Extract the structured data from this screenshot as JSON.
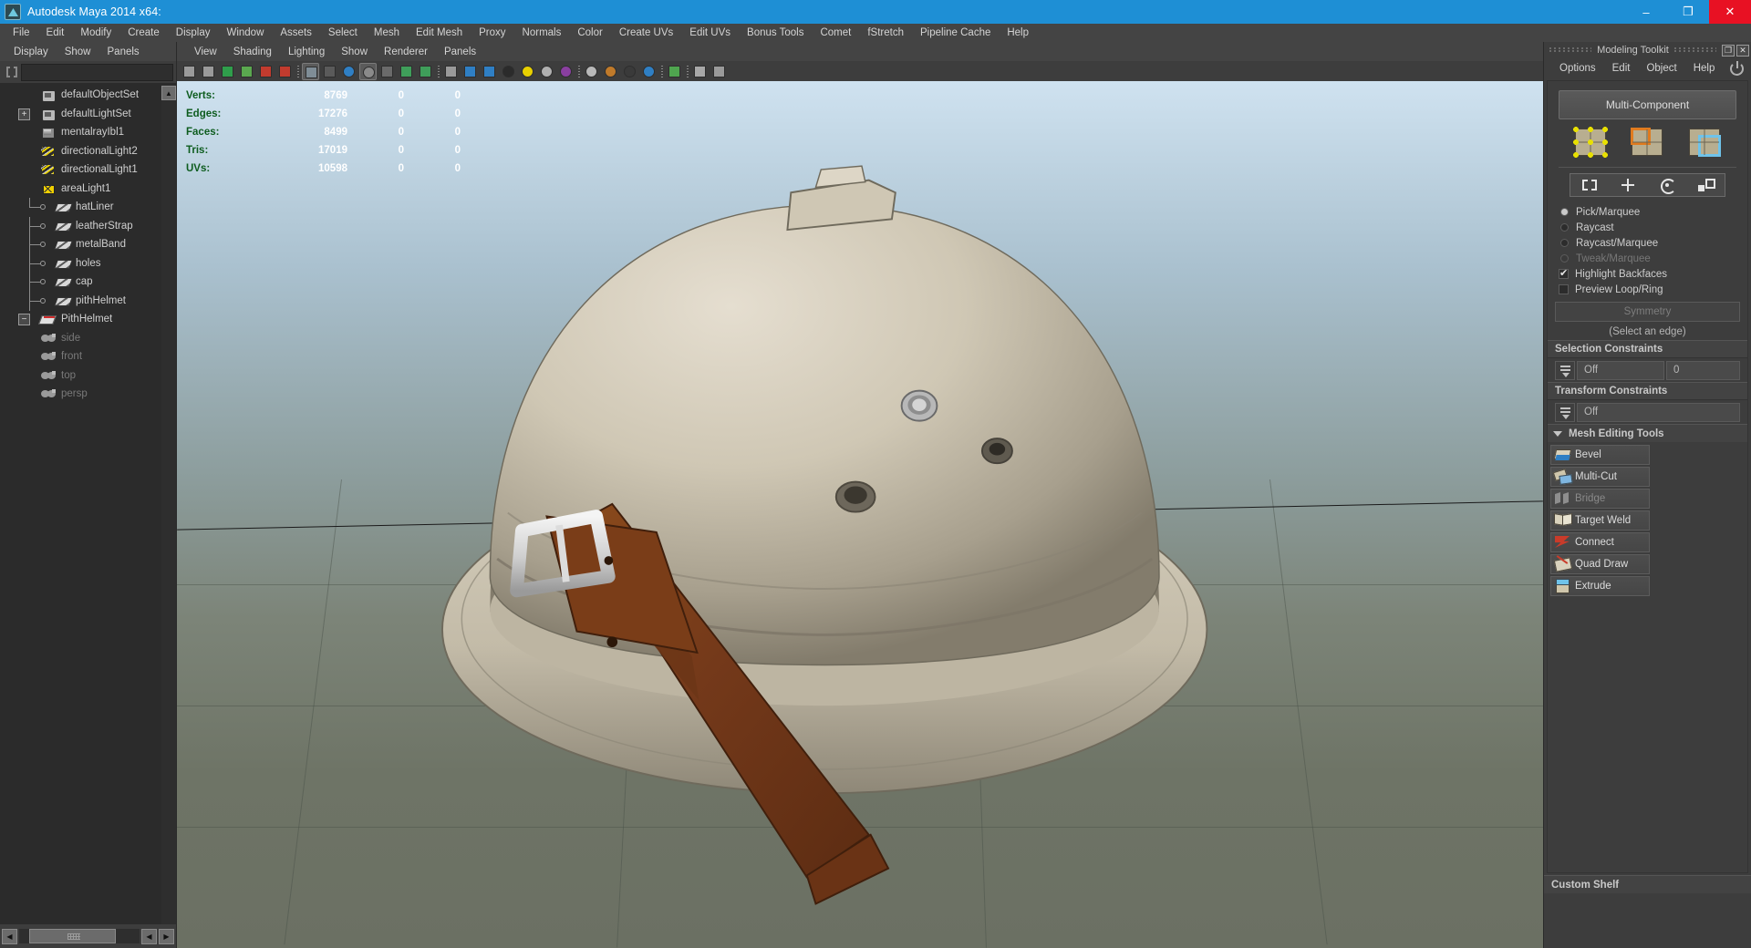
{
  "window": {
    "title": "Autodesk Maya 2014 x64:",
    "app_icon": "maya-logo-icon",
    "buttons": {
      "minimize": "–",
      "maximize": "❐",
      "close": "✕"
    }
  },
  "main_menu": [
    "File",
    "Edit",
    "Modify",
    "Create",
    "Display",
    "Window",
    "Assets",
    "Select",
    "Mesh",
    "Edit Mesh",
    "Proxy",
    "Normals",
    "Color",
    "Create UVs",
    "Edit UVs",
    "Bonus Tools",
    "Comet",
    "fStretch",
    "Pipeline Cache",
    "Help"
  ],
  "outliner": {
    "menu": [
      "Display",
      "Show",
      "Panels"
    ],
    "search_placeholder": "",
    "search_value": "",
    "nodes": [
      {
        "label": "persp",
        "icon": "camera-icon",
        "indent": 1,
        "dim": true
      },
      {
        "label": "top",
        "icon": "camera-icon",
        "indent": 1,
        "dim": true
      },
      {
        "label": "front",
        "icon": "camera-icon",
        "indent": 1,
        "dim": true
      },
      {
        "label": "side",
        "icon": "camera-icon",
        "indent": 1,
        "dim": true
      },
      {
        "label": "PithHelmet",
        "icon": "transform-icon",
        "indent": 1,
        "dim": false,
        "expander": "−"
      },
      {
        "label": "pithHelmet",
        "icon": "mesh-icon",
        "indent": 2,
        "dim": false,
        "child": true
      },
      {
        "label": "cap",
        "icon": "mesh-icon",
        "indent": 2,
        "dim": false,
        "child": true
      },
      {
        "label": "holes",
        "icon": "mesh-icon",
        "indent": 2,
        "dim": false,
        "child": true
      },
      {
        "label": "metalBand",
        "icon": "mesh-icon",
        "indent": 2,
        "dim": false,
        "child": true
      },
      {
        "label": "leatherStrap",
        "icon": "mesh-icon",
        "indent": 2,
        "dim": false,
        "child": true
      },
      {
        "label": "hatLiner",
        "icon": "mesh-icon",
        "indent": 2,
        "dim": false,
        "child": true,
        "last": true
      },
      {
        "label": "areaLight1",
        "icon": "area-light-icon",
        "indent": 1,
        "dim": false
      },
      {
        "label": "directionalLight1",
        "icon": "directional-light-icon",
        "indent": 1,
        "dim": false
      },
      {
        "label": "directionalLight2",
        "icon": "directional-light-icon",
        "indent": 1,
        "dim": false
      },
      {
        "label": "mentalrayIbl1",
        "icon": "ibl-icon",
        "indent": 1,
        "dim": false
      },
      {
        "label": "defaultLightSet",
        "icon": "set-icon",
        "indent": 1,
        "dim": false,
        "expander": "+"
      },
      {
        "label": "defaultObjectSet",
        "icon": "set-icon",
        "indent": 1,
        "dim": false
      }
    ]
  },
  "viewport": {
    "menu": [
      "View",
      "Shading",
      "Lighting",
      "Show",
      "Renderer",
      "Panels"
    ],
    "toolbar_icons": [
      "camera-icon",
      "camera-attributes-icon",
      "bookmark-icon",
      "paint-icon",
      "snap-icon",
      "brush-icon",
      "sep",
      "wireframe-icon",
      "film-gate-icon",
      "shaded-icon",
      "smooth-shade-icon",
      "xray-icon",
      "texture-icon",
      "text-icon",
      "sep",
      "wireframe-box-icon",
      "flat-shade-icon",
      "smooth-box-icon",
      "checker-icon",
      "light-bulb-icon",
      "sphere-grey-icon",
      "sphere-purple-icon",
      "sep",
      "default-light-icon",
      "all-lights-icon",
      "shadow-icon",
      "ao-icon",
      "sep",
      "marquee-select-icon",
      "sep",
      "box-icon",
      "grid-icon"
    ],
    "hud": {
      "rows": [
        {
          "label": "Verts:",
          "v1": "8769",
          "v2": "0",
          "v3": "0"
        },
        {
          "label": "Edges:",
          "v1": "17276",
          "v2": "0",
          "v3": "0"
        },
        {
          "label": "Faces:",
          "v1": "8499",
          "v2": "0",
          "v3": "0"
        },
        {
          "label": "Tris:",
          "v1": "17019",
          "v2": "0",
          "v3": "0"
        },
        {
          "label": "UVs:",
          "v1": "10598",
          "v2": "0",
          "v3": "0"
        }
      ]
    }
  },
  "modeling_toolkit": {
    "panel_title": "Modeling Toolkit",
    "win_buttons": {
      "float": "❐",
      "close": "✕"
    },
    "menu": [
      "Options",
      "Edit",
      "Object",
      "Help"
    ],
    "power_icon": "power-icon",
    "multi_component_label": "Multi-Component",
    "component_modes": [
      {
        "name": "vertex-component-icon",
        "label": "Vertex"
      },
      {
        "name": "edge-component-icon",
        "label": "Edge"
      },
      {
        "name": "face-component-icon",
        "label": "Face"
      }
    ],
    "transform_tools": [
      {
        "name": "marquee-tool-icon",
        "label": "Select"
      },
      {
        "name": "move-tool-icon",
        "label": "Move"
      },
      {
        "name": "rotate-tool-icon",
        "label": "Rotate"
      },
      {
        "name": "scale-tool-icon",
        "label": "Scale"
      }
    ],
    "selection_modes": [
      {
        "label": "Pick/Marquee",
        "selected": true,
        "disabled": false
      },
      {
        "label": "Raycast",
        "selected": false,
        "disabled": false
      },
      {
        "label": "Raycast/Marquee",
        "selected": false,
        "disabled": false
      },
      {
        "label": "Tweak/Marquee",
        "selected": false,
        "disabled": true
      }
    ],
    "checkboxes": [
      {
        "label": "Highlight Backfaces",
        "checked": true
      },
      {
        "label": "Preview Loop/Ring",
        "checked": false
      }
    ],
    "symmetry_button": "Symmetry",
    "symmetry_hint": "(Select an edge)",
    "selection_constraints": {
      "header": "Selection Constraints",
      "mode": "Off",
      "value": "0"
    },
    "transform_constraints": {
      "header": "Transform Constraints",
      "mode": "Off"
    },
    "mesh_editing": {
      "header": "Mesh Editing Tools",
      "tools": [
        {
          "label": "Bevel",
          "icon": "bevel-icon",
          "disabled": false
        },
        {
          "label": "Multi-Cut",
          "icon": "multi-cut-icon",
          "disabled": false
        },
        {
          "label": "Bridge",
          "icon": "bridge-icon",
          "disabled": true
        },
        {
          "label": "Target Weld",
          "icon": "target-weld-icon",
          "disabled": false
        },
        {
          "label": "Connect",
          "icon": "connect-icon",
          "disabled": false
        },
        {
          "label": "Quad Draw",
          "icon": "quad-draw-icon",
          "disabled": false
        },
        {
          "label": "Extrude",
          "icon": "extrude-icon",
          "disabled": false
        }
      ]
    },
    "custom_shelf": "Custom Shelf"
  },
  "colors": {
    "title_bar": "#1e8fd5",
    "close_button": "#e81123",
    "panel_bg": "#3d3d3d",
    "tree_bg": "#2b2b2b",
    "hud_label": "#0d5c1e",
    "accent_orange": "#e07b1f",
    "accent_blue": "#6fc3ea",
    "accent_yellow": "#e8e000"
  }
}
